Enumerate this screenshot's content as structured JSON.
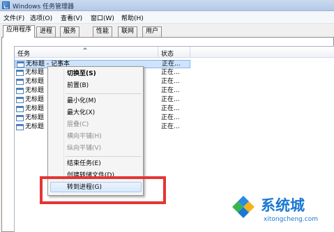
{
  "window": {
    "title": "Windows 任务管理器"
  },
  "menubar": {
    "items": [
      "文件(F)",
      "选项(O)",
      "查看(V)",
      "窗口(W)",
      "帮助(H)"
    ]
  },
  "tabs": [
    {
      "label": "应用程序",
      "active": true
    },
    {
      "label": "进程"
    },
    {
      "label": "服务"
    },
    {
      "label": "性能"
    },
    {
      "label": "联网"
    },
    {
      "label": "用户"
    }
  ],
  "task_list": {
    "columns": {
      "task": "任务",
      "status": "状态"
    },
    "rows": [
      {
        "task": "无标题 - 记事本",
        "status": "正在...",
        "selected": true
      },
      {
        "task": "无标题",
        "status": "正在..."
      },
      {
        "task": "无标题",
        "status": "正在..."
      },
      {
        "task": "无标题",
        "status": "正在..."
      },
      {
        "task": "无标题",
        "status": "正在..."
      },
      {
        "task": "无标题",
        "status": "正在..."
      },
      {
        "task": "无标题",
        "status": "正在..."
      },
      {
        "task": "无标题",
        "status": "正在..."
      }
    ]
  },
  "context_menu": {
    "items": [
      {
        "label": "切换至(S)",
        "bold": true,
        "enabled": true
      },
      {
        "label": "前置(B)",
        "enabled": true
      },
      {
        "label": "最小化(M)",
        "enabled": true
      },
      {
        "label": "最大化(X)",
        "enabled": true
      },
      {
        "label": "层叠(C)",
        "enabled": false
      },
      {
        "label": "横向平铺(H)",
        "enabled": false
      },
      {
        "label": "纵向平铺(V)",
        "enabled": false
      },
      {
        "label": "结束任务(E)",
        "enabled": true
      },
      {
        "label": "创建转储文件(D)",
        "enabled": true
      },
      {
        "label": "转到进程(G)",
        "enabled": true,
        "highlighted": true
      }
    ]
  },
  "annotation": {
    "color": "#e53535"
  },
  "watermark": {
    "name": "系统城",
    "url": "xitongcheng.com",
    "color": "#1a78d2"
  }
}
